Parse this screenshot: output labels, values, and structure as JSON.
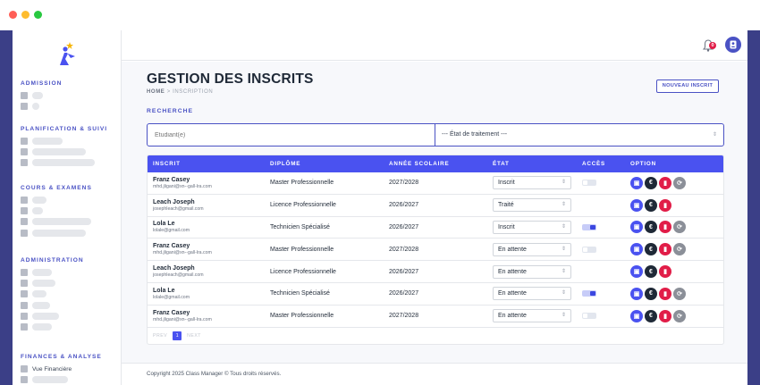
{
  "window": {
    "colors": {
      "close": "#ff5f57",
      "minimize": "#febc2e",
      "maximize": "#28c840",
      "accent": "#4a52f0",
      "danger": "#e11d48"
    }
  },
  "sidebar": {
    "logo_icon": "person-star-logo",
    "sections": [
      {
        "title": "ADMISSION",
        "items": [
          {
            "label": ""
          },
          {
            "label": ""
          }
        ]
      },
      {
        "title": "PLANIFICATION & SUIVI",
        "items": [
          {
            "label": ""
          },
          {
            "label": ""
          },
          {
            "label": ""
          }
        ]
      },
      {
        "title": "COURS & EXAMENS",
        "items": [
          {
            "label": ""
          },
          {
            "label": ""
          },
          {
            "label": ""
          },
          {
            "label": ""
          }
        ]
      },
      {
        "title": "ADMINISTRATION",
        "items": [
          {
            "label": ""
          },
          {
            "label": ""
          },
          {
            "label": ""
          },
          {
            "label": ""
          },
          {
            "label": ""
          },
          {
            "label": ""
          }
        ]
      },
      {
        "title": "FINANCES & ANALYSE",
        "items": [
          {
            "label": "Vue Financière"
          },
          {
            "label": ""
          }
        ]
      }
    ]
  },
  "header": {
    "notification_count": "0",
    "bell_icon": "bell-icon",
    "user_icon": "user-icon"
  },
  "page": {
    "title": "GESTION DES INSCRITS",
    "breadcrumb_home": "HOME",
    "breadcrumb_sep": ">",
    "breadcrumb_current": "INSCRIPTION",
    "new_button": "NOUVEAU INSCRIT"
  },
  "search": {
    "label": "RECHERCHE",
    "student_placeholder": "Étudiant(e)",
    "status_select": "--- État de traitement ---"
  },
  "table": {
    "columns": [
      "INSCRIT",
      "DIPLÔME",
      "ANNÉE SCOLAIRE",
      "ÉTAT",
      "ACCÈS",
      "OPTION"
    ],
    "rows": [
      {
        "name": "Franz Casey",
        "email": "mhd.jligani@xn--gall-lra.com",
        "diploma": "Master Professionnelle",
        "year": "2027/2028",
        "status": "Inscrit",
        "access": true,
        "access_on": false,
        "sync": true
      },
      {
        "name": "Leach Joseph",
        "email": "josephleach@gmail.com",
        "diploma": "Licence Professionnelle",
        "year": "2026/2027",
        "status": "Traité",
        "access": false,
        "access_on": false,
        "sync": false
      },
      {
        "name": "Lola Le",
        "email": "lolale@gmail.com",
        "diploma": "Technicien Spécialisé",
        "year": "2026/2027",
        "status": "Inscrit",
        "access": true,
        "access_on": true,
        "sync": true
      },
      {
        "name": "Franz Casey",
        "email": "mhd.jligani@xn--gall-lra.com",
        "diploma": "Master Professionnelle",
        "year": "2027/2028",
        "status": "En attente",
        "access": true,
        "access_on": false,
        "sync": true
      },
      {
        "name": "Leach Joseph",
        "email": "josephleach@gmail.com",
        "diploma": "Licence Professionnelle",
        "year": "2026/2027",
        "status": "En attente",
        "access": false,
        "access_on": false,
        "sync": false
      },
      {
        "name": "Lola Le",
        "email": "lolale@gmail.com",
        "diploma": "Technicien Spécialisé",
        "year": "2026/2027",
        "status": "En attente",
        "access": true,
        "access_on": true,
        "sync": true
      },
      {
        "name": "Franz Casey",
        "email": "mhd.jligani@xn--gall-lra.com",
        "diploma": "Master Professionnelle",
        "year": "2027/2028",
        "status": "En attente",
        "access": true,
        "access_on": false,
        "sync": true
      }
    ]
  },
  "pagination": {
    "prev": "PREV",
    "current": "1",
    "next": "NEXT"
  },
  "footer": {
    "text": "Copyright 2025 Class Manager © Tous droits réservés."
  }
}
